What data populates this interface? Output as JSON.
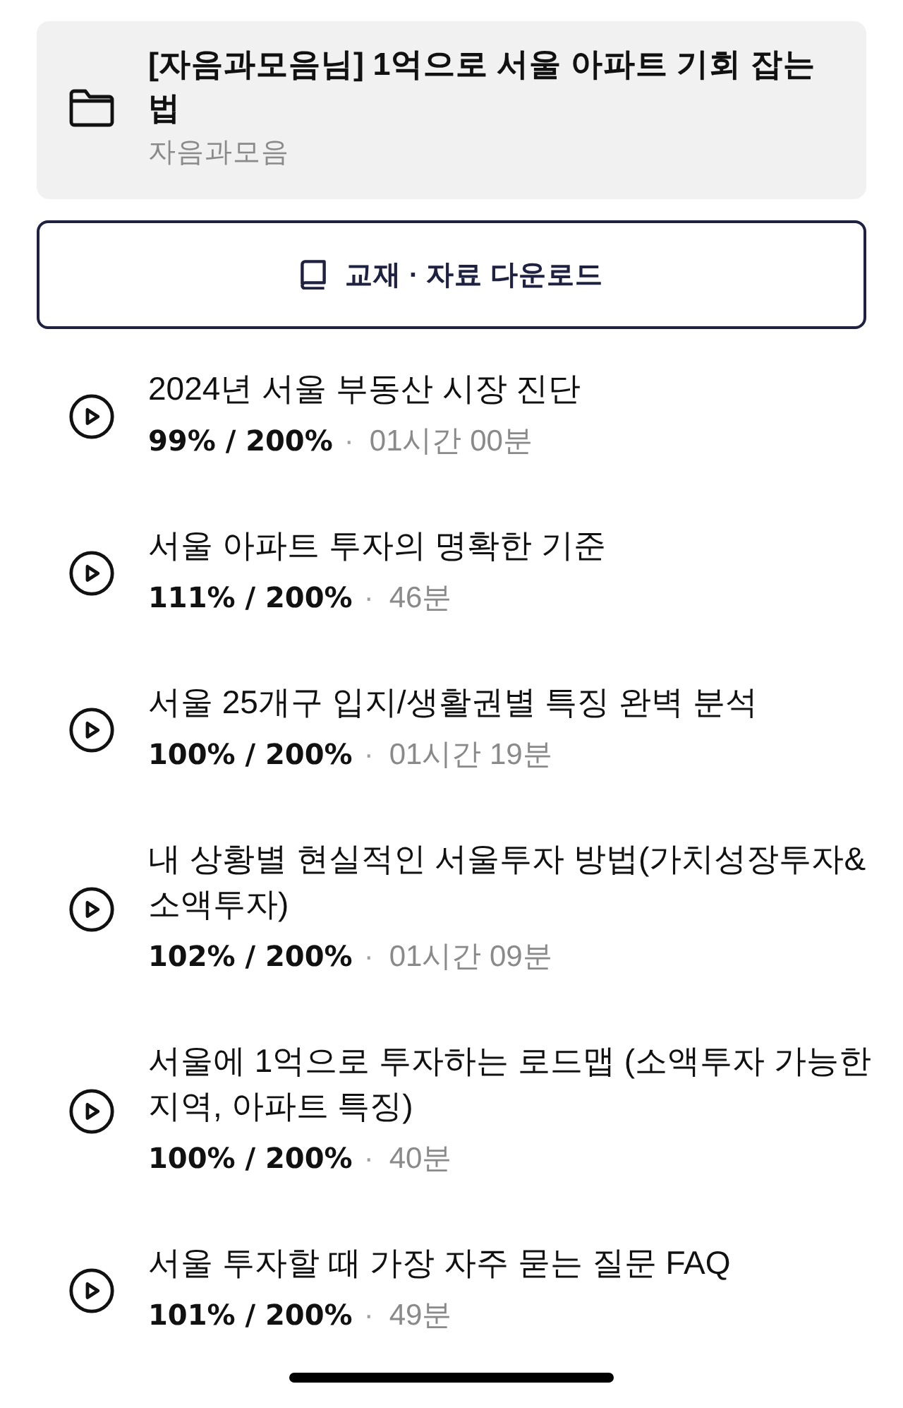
{
  "course": {
    "title": "[자음과모음님] 1억으로 서울 아파트 기회 잡는 법",
    "author": "자음과모음"
  },
  "download_button": {
    "label": "교재 · 자료 다운로드"
  },
  "lectures": [
    {
      "title": "2024년 서울 부동산 시장 진단",
      "progress": "99% / 200%",
      "separator": "·",
      "duration": "01시간 00분"
    },
    {
      "title": "서울 아파트 투자의 명확한 기준",
      "progress": "111% / 200%",
      "separator": "·",
      "duration": "46분"
    },
    {
      "title": "서울 25개구 입지/생활권별 특징 완벽 분석",
      "progress": "100% / 200%",
      "separator": "·",
      "duration": "01시간 19분"
    },
    {
      "title": "내 상황별 현실적인 서울투자 방법(가치성장투자&소액투자)",
      "progress": "102% / 200%",
      "separator": "·",
      "duration": "01시간 09분"
    },
    {
      "title": "서울에 1억으로 투자하는 로드맵 (소액투자 가능한 지역, 아파트 특징)",
      "progress": "100% / 200%",
      "separator": "·",
      "duration": "40분"
    },
    {
      "title": "서울 투자할 때 가장 자주 묻는 질문 FAQ",
      "progress": "101% / 200%",
      "separator": "·",
      "duration": "49분"
    }
  ]
}
